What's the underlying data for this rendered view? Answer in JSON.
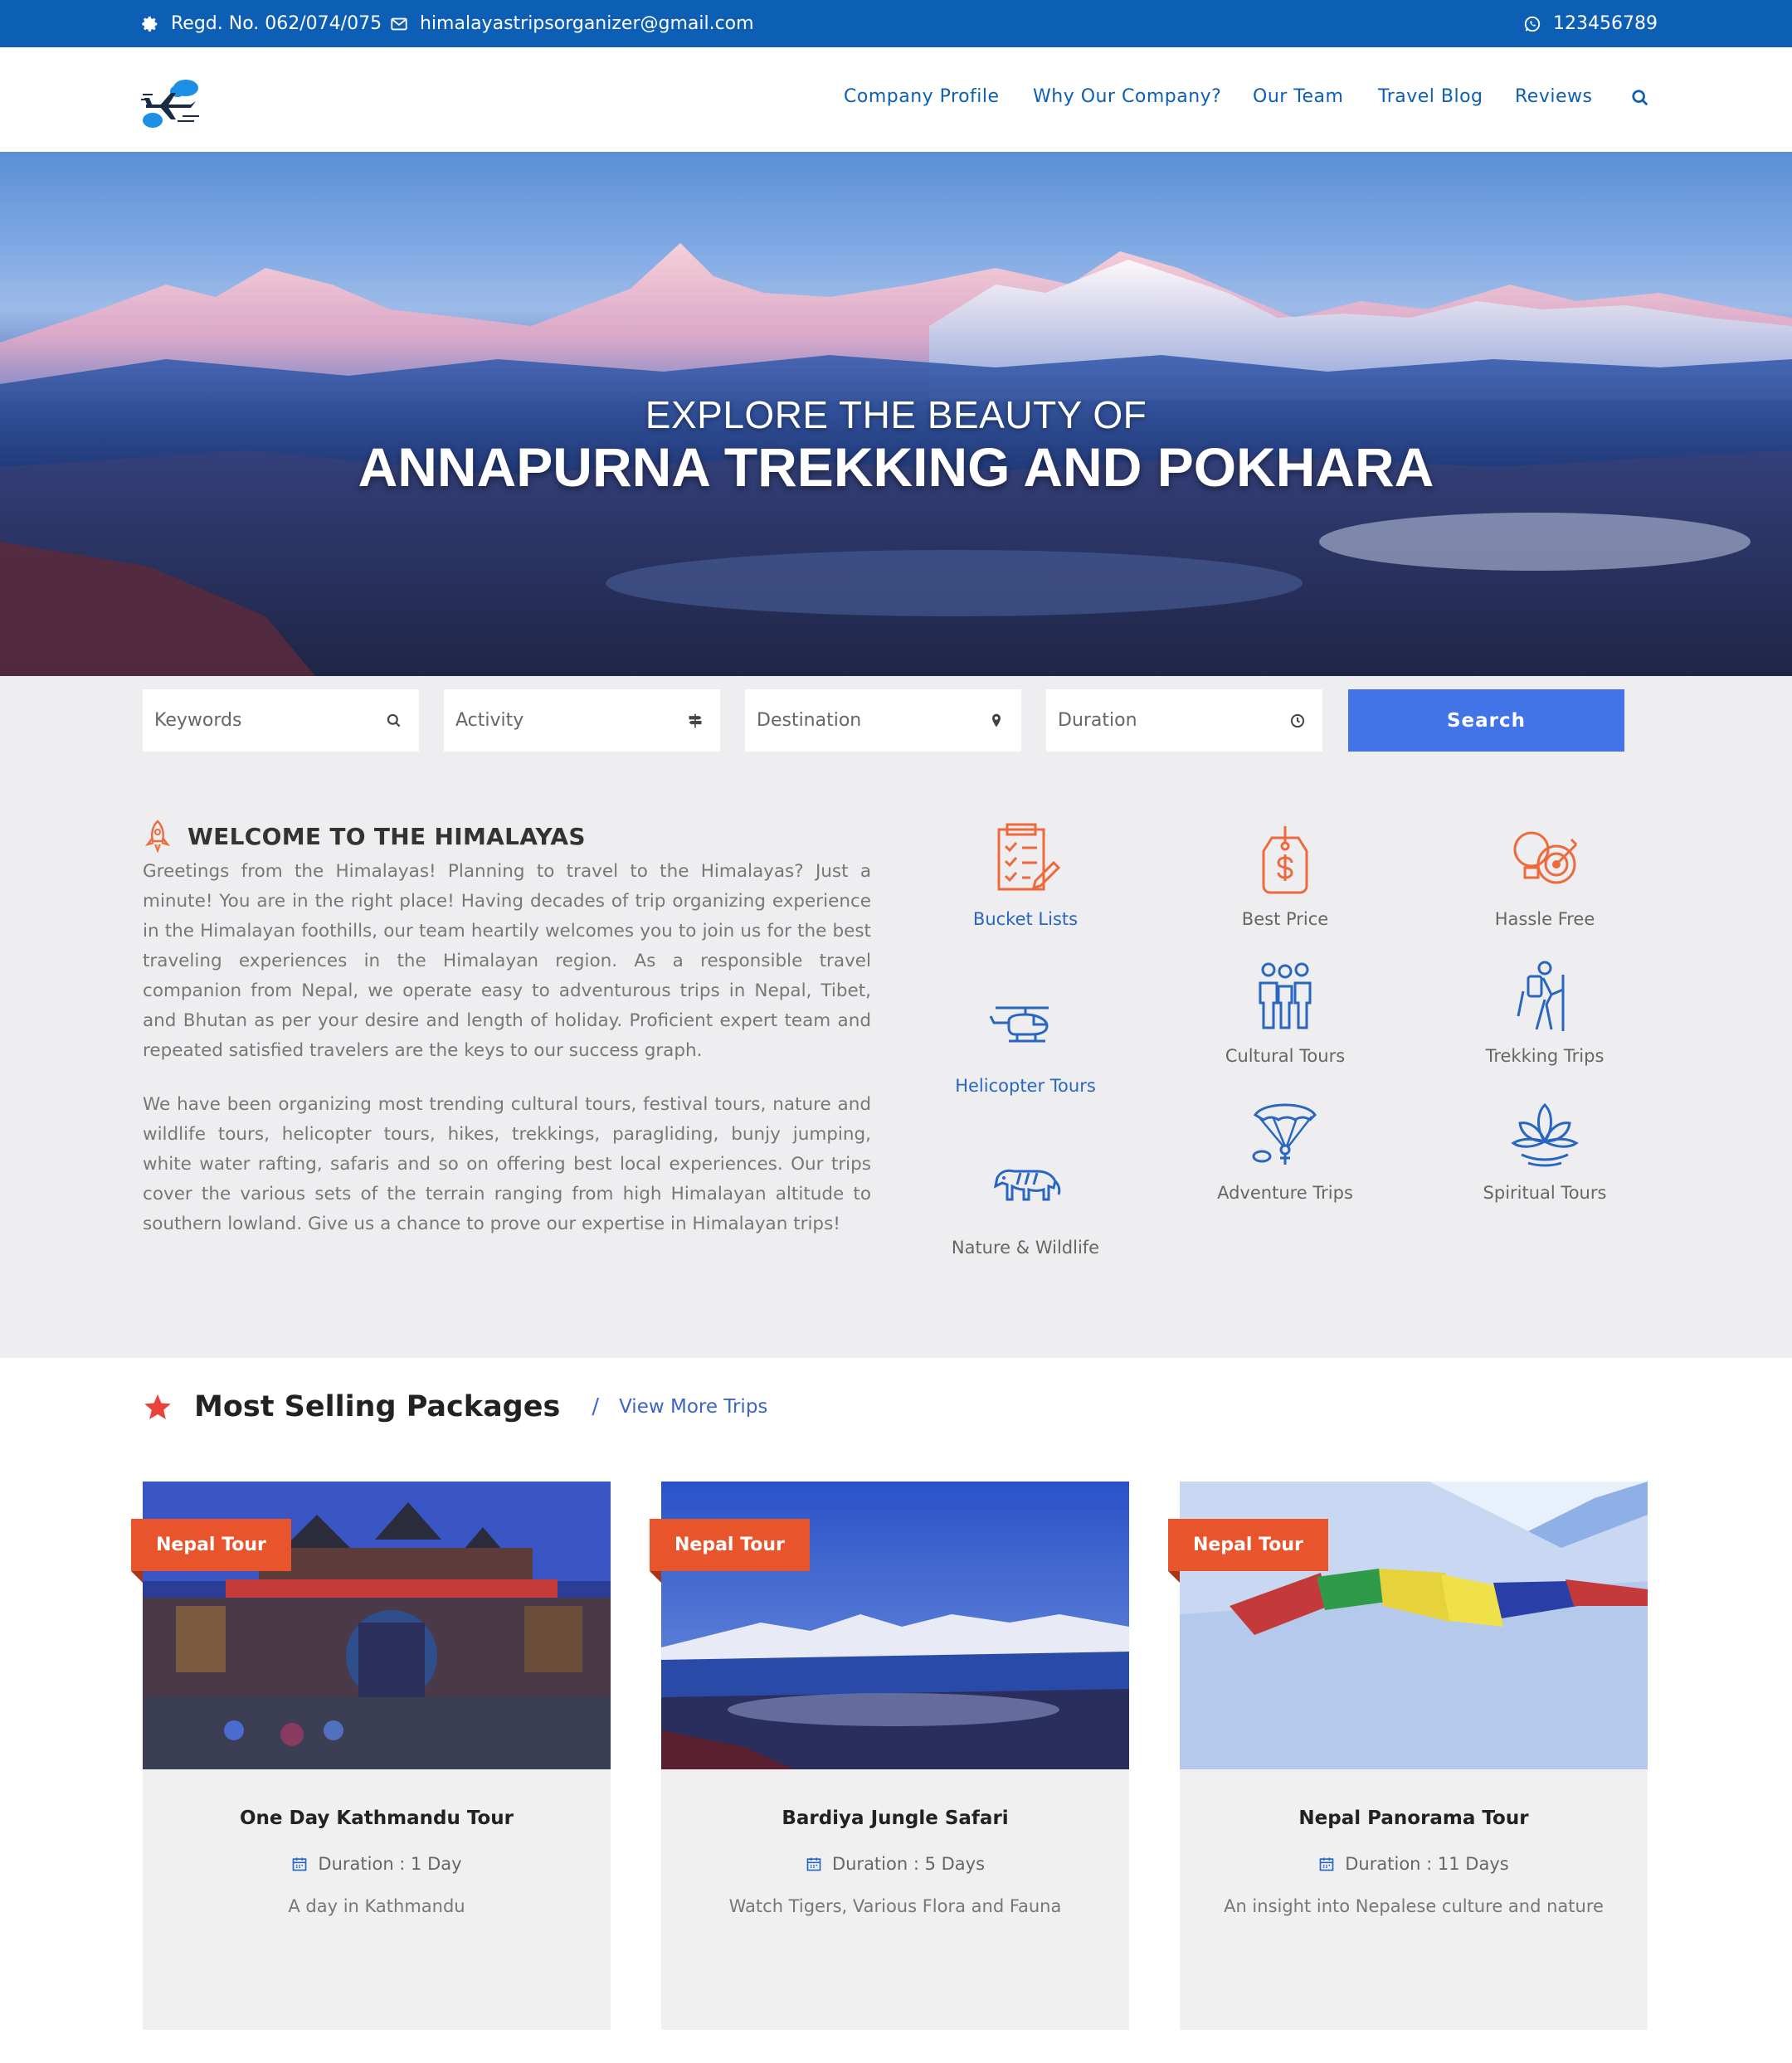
{
  "topbar": {
    "registration": "Regd. No. 062/074/075",
    "email": "himalayastripsorganizer@gmail.com",
    "phone": "123456789"
  },
  "nav": {
    "items": [
      "Company Profile",
      "Why Our Company?",
      "Our Team",
      "Travel Blog",
      "Reviews"
    ]
  },
  "hero": {
    "subtitle": "EXPLORE THE BEAUTY OF",
    "title": "ANNAPURNA TREKKING AND POKHARA"
  },
  "search": {
    "keywords_placeholder": "Keywords",
    "activity_placeholder": "Activity",
    "destination_placeholder": "Destination",
    "duration_placeholder": "Duration",
    "button_label": "Search"
  },
  "welcome": {
    "title": "WELCOME TO THE HIMALAYAS",
    "paragraph1": "Greetings from the Himalayas! Planning to travel to the Himalayas? Just a minute! You are in the right place! Having decades of trip organizing experience in the Himalayan foothills, our team heartily welcomes you to join us for the best traveling experiences in the Himalayan region. As a responsible travel companion from Nepal, we operate easy to adventurous trips in Nepal, Tibet, and Bhutan as per your desire and length of holiday. Proficient expert team and repeated satisfied travelers are the keys to our success graph.",
    "paragraph2": "We have been organizing most trending cultural tours, festival tours, nature and wildlife tours, helicopter tours, hikes, trekkings, paragliding, bunjy jumping, white water rafting, safaris and so on offering best local experiences. Our trips cover the various sets of the terrain ranging from high Himalayan altitude to southern lowland. Give us a chance to prove our expertise in Himalayan trips!"
  },
  "features": [
    {
      "label": "Bucket Lists",
      "icon": "checklist-icon"
    },
    {
      "label": "Best Price",
      "icon": "price-tag-icon"
    },
    {
      "label": "Hassle Free",
      "icon": "lightbulb-target-icon"
    },
    {
      "label": "Helicopter Tours",
      "icon": "helicopter-icon"
    },
    {
      "label": "Cultural Tours",
      "icon": "people-icon"
    },
    {
      "label": "Trekking Trips",
      "icon": "hiker-icon"
    },
    {
      "label": "Adventure Trips",
      "icon": "paraglider-icon"
    },
    {
      "label": "Spiritual Tours",
      "icon": "lotus-icon"
    },
    {
      "label": "Nature & Wildlife",
      "icon": "tiger-icon"
    }
  ],
  "packages": {
    "heading": "Most Selling Packages",
    "separator": "/",
    "view_more": "View More Trips",
    "items": [
      {
        "tag": "Nepal Tour",
        "name": "One Day Kathmandu Tour",
        "duration": "Duration : 1 Day",
        "description": "A day in Kathmandu"
      },
      {
        "tag": "Nepal Tour",
        "name": "Bardiya Jungle Safari",
        "duration": "Duration : 5 Days",
        "description": "Watch Tigers, Various Flora and Fauna"
      },
      {
        "tag": "Nepal Tour",
        "name": "Nepal Panorama Tour",
        "duration": "Duration : 11 Days",
        "description": "An insight into Nepalese culture and nature"
      }
    ]
  },
  "colors": {
    "primary_blue": "#0d5fb5",
    "search_button": "#4274e8",
    "tag_orange": "#e8542b",
    "icon_orange": "#ee6a3c",
    "icon_blue": "#2866c2"
  }
}
